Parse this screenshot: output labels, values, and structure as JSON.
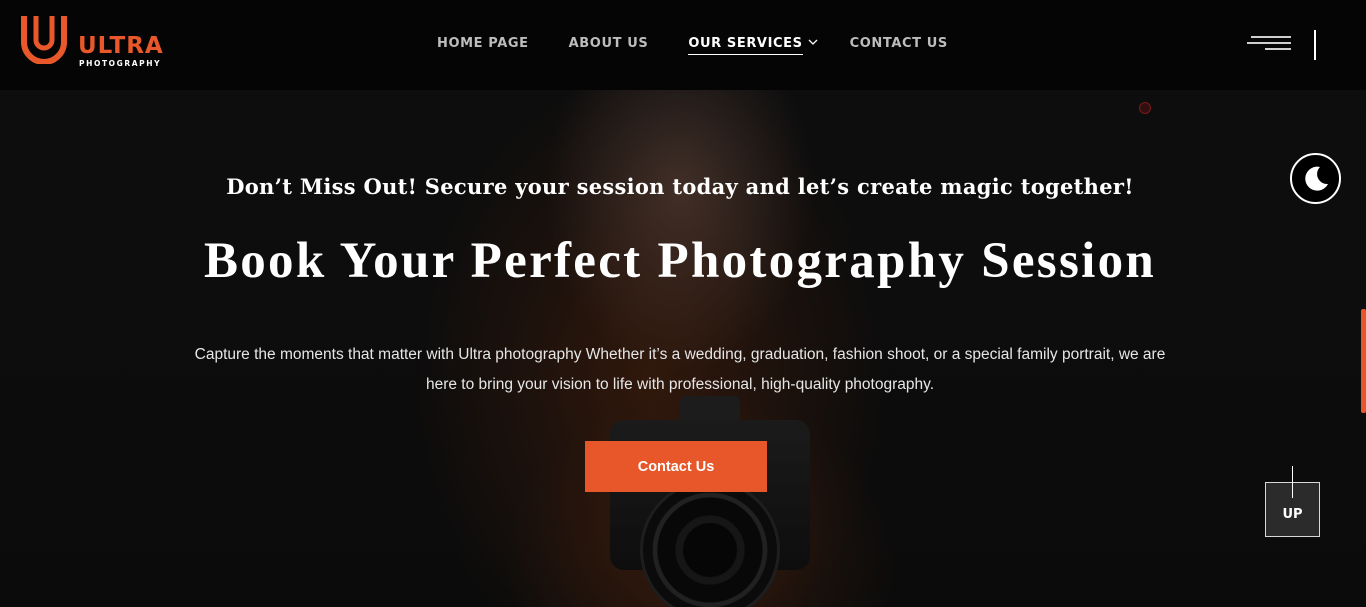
{
  "brand": {
    "name": "ULTRA",
    "subtitle": "PHOTOGRAPHY",
    "accent_color": "#e8582a"
  },
  "nav": {
    "items": [
      {
        "label": "HOME PAGE",
        "active": false
      },
      {
        "label": "ABOUT US",
        "active": false
      },
      {
        "label": "OUR SERVICES",
        "active": true,
        "has_dropdown": true
      },
      {
        "label": "CONTACT US",
        "active": false
      }
    ],
    "menu_icon": "hamburger-icon"
  },
  "hero": {
    "tagline": "Don’t Miss Out! Secure your session today and let’s create magic together!",
    "title": "Book Your Perfect Photography Session",
    "description": "Capture the moments that matter with Ultra photography Whether it’s a wedding, graduation, fashion shoot, or a special family portrait, we are here to bring your vision to life with professional, high-quality photography.",
    "cta_label": "Contact Us",
    "background_image": "woman-with-camera-photo"
  },
  "controls": {
    "theme_toggle_icon": "moon-icon",
    "scroll_up_label": "UP"
  }
}
